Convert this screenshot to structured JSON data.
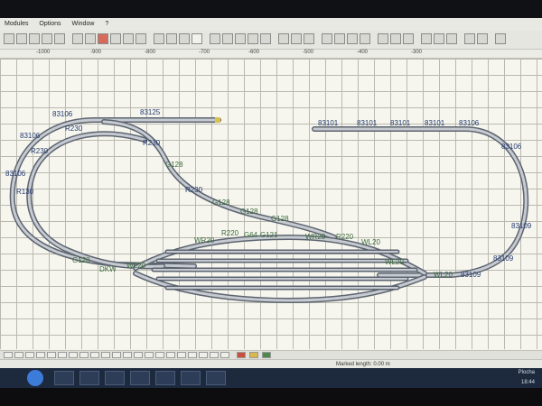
{
  "menu": {
    "items": [
      "Modules",
      "Options",
      "Window",
      "?"
    ]
  },
  "ruler": {
    "marks": [
      "-1000",
      "-900",
      "-800",
      "-700",
      "-600",
      "-500",
      "-400",
      "-300"
    ]
  },
  "track_labels": {
    "top_straight": "83125",
    "top_left_1": "83106",
    "top_left_2": "83106",
    "r230_a": "R230",
    "r230_b": "R230",
    "r230_c": "R230",
    "r230_d": "R230",
    "left_1": "83106",
    "left_2": "R130",
    "right_straight_1": "83101",
    "right_straight_2": "83101",
    "right_straight_3": "83101",
    "right_straight_4": "83101",
    "right_curve_1": "83106",
    "right_curve_2": "83106",
    "right_curve_3": "83109",
    "right_curve_4": "83109",
    "right_curve_5": "83109",
    "g128_a": "G128",
    "g128_b": "G128",
    "g128_c": "G128",
    "g128_d": "G128",
    "g128_e": "G128",
    "r220": "R220",
    "g64": "G64",
    "g121": "G121",
    "wr20_a": "WR20",
    "wr20_b": "WR20",
    "wl20_a": "WL20",
    "wl20_b": "WL20",
    "wl20_c": "WL20",
    "wl20_d": "WL20",
    "r220_b": "R220",
    "dkw": "DKW"
  },
  "status": {
    "marked_length": "Marked length: 0.00 m"
  },
  "taskbar": {
    "lang": "Plocha",
    "time": "18:44"
  }
}
